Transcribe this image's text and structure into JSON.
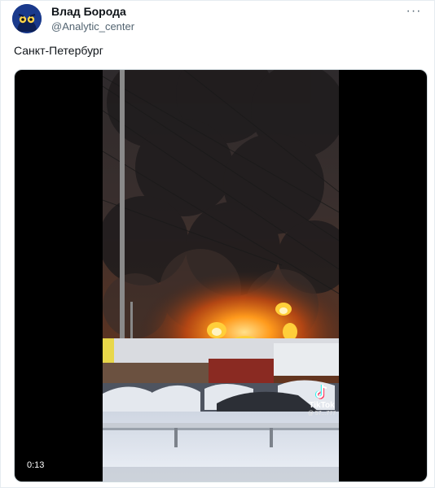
{
  "author": {
    "name": "Влад Борода",
    "handle": "@Analytic_center"
  },
  "tweet": {
    "text": "Санкт-Петербург"
  },
  "video": {
    "duration": "0:13",
    "watermark": "TikTok",
    "watermark_user": "@ 57...777"
  },
  "colors": {
    "avatar_bg": "#1d3d8f",
    "handle": "#536471",
    "fire": "#ff7a12"
  },
  "icons": {
    "more": "more-horizontal-icon",
    "tiktok": "tiktok-logo-icon"
  }
}
